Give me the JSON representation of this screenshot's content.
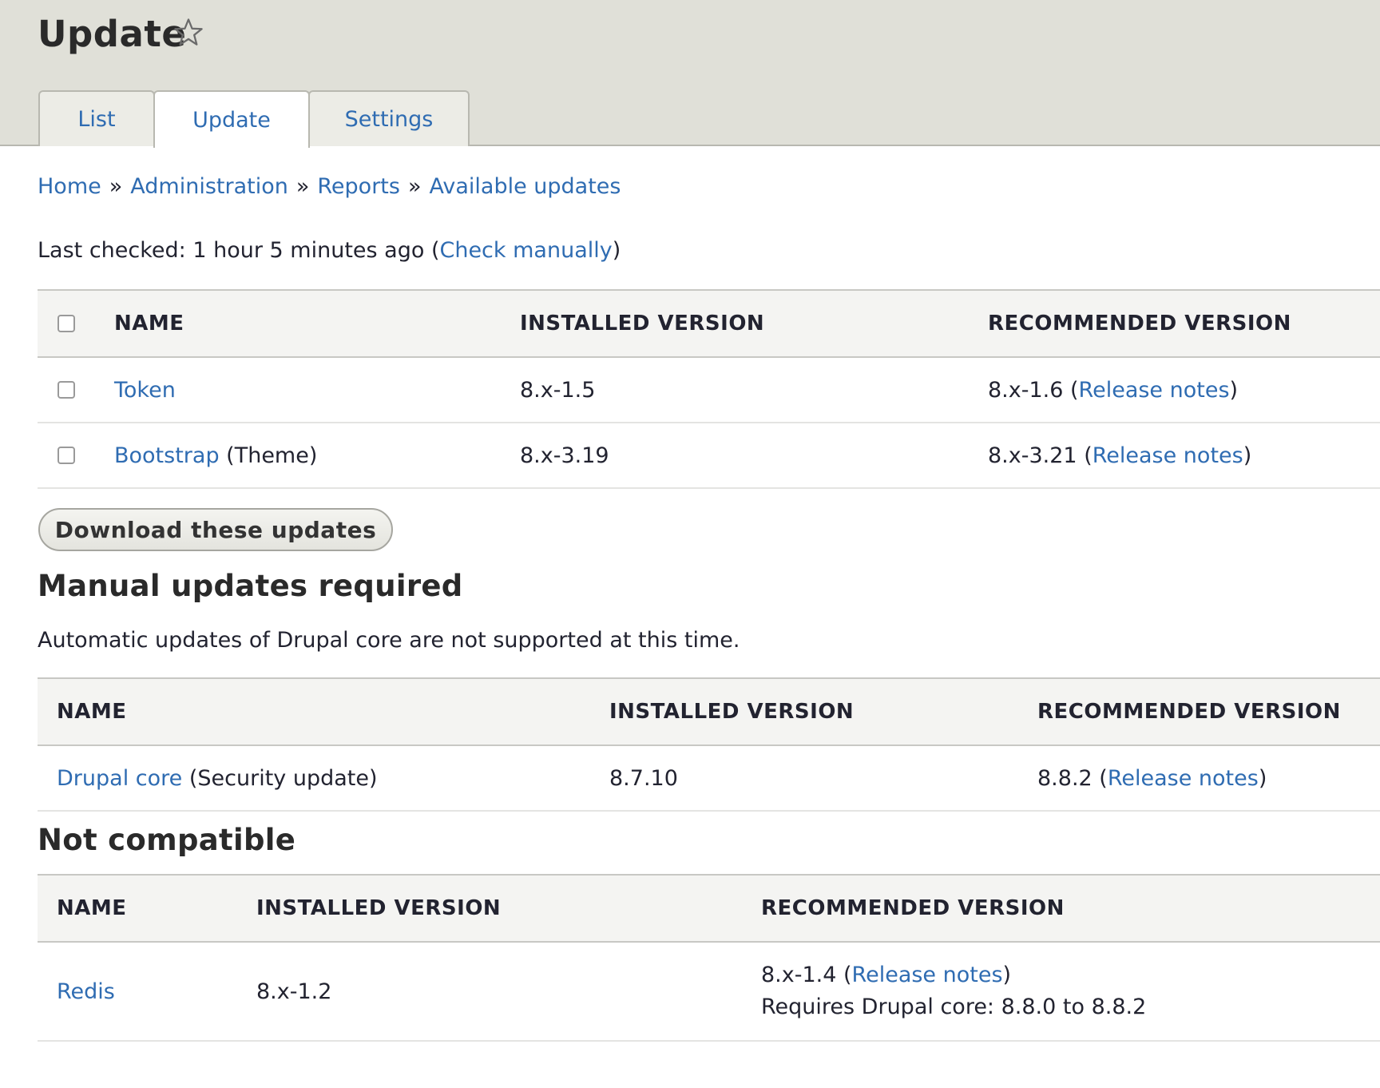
{
  "header": {
    "title": "Update"
  },
  "tabs": [
    {
      "label": "List"
    },
    {
      "label": "Update"
    },
    {
      "label": "Settings"
    }
  ],
  "breadcrumb": {
    "items": [
      "Home",
      "Administration",
      "Reports",
      "Available updates"
    ],
    "separator": "»"
  },
  "status": {
    "prefix": "Last checked: 1 hour 5 minutes ago (",
    "link": "Check manually",
    "suffix": ")"
  },
  "updates_table": {
    "columns": [
      "NAME",
      "INSTALLED VERSION",
      "RECOMMENDED VERSION"
    ],
    "rows": [
      {
        "name": "Token",
        "extra": "",
        "installed": "8.x-1.5",
        "recommended": "8.x-1.6",
        "notes": "Release notes"
      },
      {
        "name": "Bootstrap",
        "extra": " (Theme)",
        "installed": "8.x-3.19",
        "recommended": "8.x-3.21",
        "notes": "Release notes"
      }
    ]
  },
  "download_button": {
    "label": "Download these updates"
  },
  "manual": {
    "heading": "Manual updates required",
    "description": "Automatic updates of Drupal core are not supported at this time.",
    "columns": [
      "NAME",
      "INSTALLED VERSION",
      "RECOMMENDED VERSION"
    ],
    "rows": [
      {
        "name": "Drupal core",
        "extra": " (Security update)",
        "installed": "8.7.10",
        "recommended": "8.8.2",
        "notes": "Release notes"
      }
    ]
  },
  "incompatible": {
    "heading": "Not compatible",
    "columns": [
      "NAME",
      "INSTALLED VERSION",
      "RECOMMENDED VERSION"
    ],
    "rows": [
      {
        "name": "Redis",
        "installed": "8.x-1.2",
        "recommended": "8.x-1.4",
        "notes": "Release notes",
        "requirement": "Requires Drupal core: 8.8.0 to 8.8.2"
      }
    ]
  },
  "colors": {
    "link": "#2f6cb2",
    "header_bg": "#e0e0d8",
    "text": "#222330"
  }
}
